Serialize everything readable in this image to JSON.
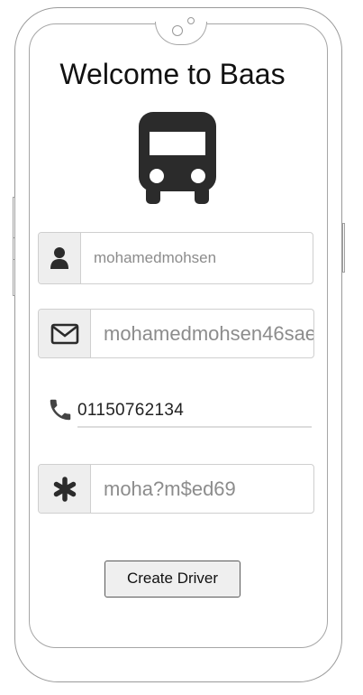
{
  "header": {
    "title": "Welcome to Baas"
  },
  "icons": {
    "logo": "bus-icon",
    "user": "user-icon",
    "email": "envelope-icon",
    "phone": "phone-icon",
    "password": "asterisk-icon"
  },
  "form": {
    "username_value": "mohamedmohsen",
    "email_value": "mohamedmohsen46sae",
    "phone_value": "01150762134",
    "password_value": "moha?m$ed69",
    "submit_label": "Create Driver"
  },
  "colors": {
    "icon": "#2b2b2b",
    "addon_bg": "#eeeeee",
    "field_text": "#8c8c8c"
  }
}
